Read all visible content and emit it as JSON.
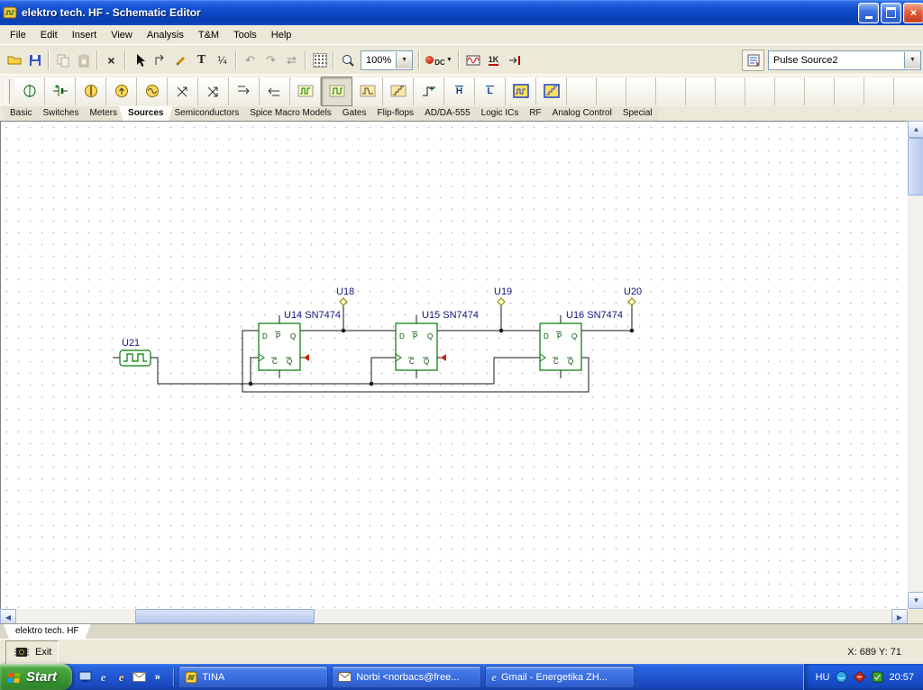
{
  "window": {
    "title": "elektro tech. HF - Schematic Editor"
  },
  "menubar": {
    "items": [
      "File",
      "Edit",
      "Insert",
      "View",
      "Analysis",
      "T&M",
      "Tools",
      "Help"
    ]
  },
  "toolbar": {
    "zoom_value": "100%",
    "dc_label": "DC",
    "ik_label": "1K",
    "component_selector": "Pulse Source2"
  },
  "component_tabs": {
    "items": [
      "Basic",
      "Switches",
      "Meters",
      "Sources",
      "Semiconductors",
      "Spice Macro Models",
      "Gates",
      "Flip-flops",
      "AD/DA-555",
      "Logic ICs",
      "RF",
      "Analog Control",
      "Special"
    ],
    "active": "Sources"
  },
  "component_icons": {
    "high": "H",
    "low": "L"
  },
  "schematic": {
    "pulse_source": {
      "label": "U21"
    },
    "flipflops": [
      {
        "label": "U14 SN7474"
      },
      {
        "label": "U15 SN7474"
      },
      {
        "label": "U16 SN7474"
      }
    ],
    "output_pins": [
      {
        "label": "U18"
      },
      {
        "label": "U19"
      },
      {
        "label": "U20"
      }
    ],
    "pin_letters": {
      "d": "D",
      "p": "P",
      "q": "Q",
      "c": "C",
      "qb": "Q"
    }
  },
  "sheet_tab": {
    "label": "elektro tech. HF"
  },
  "statusbar": {
    "exit_label": "Exit",
    "coordinates": "X: 689 Y: 71"
  },
  "taskbar": {
    "start_label": "Start",
    "tasks": [
      {
        "label": "TINA"
      },
      {
        "label": "Norbi <norbacs@free..."
      },
      {
        "label": "Gmail - Energetika ZH..."
      }
    ],
    "tray": {
      "language": "HU",
      "time": "20:57"
    }
  },
  "colors": {
    "titlebar_blue": "#0B44BE",
    "taskbar_blue": "#2258D2",
    "start_green": "#3E9A35",
    "component_green": "#007A00",
    "wire_black": "#1A1A1A",
    "label_navy": "#16167C"
  }
}
